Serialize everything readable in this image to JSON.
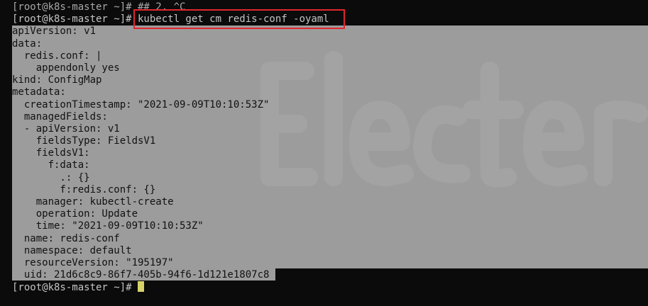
{
  "terminal": {
    "lines": [
      {
        "text": "[root@k8s-master ~]# ## 2. ^C",
        "style": "dim"
      },
      {
        "text": "[root@k8s-master ~]# kubectl get cm redis-conf -oyaml",
        "style": "prompt"
      },
      {
        "text": "apiVersion: v1",
        "style": "sel"
      },
      {
        "text": "data:",
        "style": "sel"
      },
      {
        "text": "  redis.conf: |",
        "style": "sel"
      },
      {
        "text": "    appendonly yes",
        "style": "sel"
      },
      {
        "text": "kind: ConfigMap",
        "style": "sel"
      },
      {
        "text": "metadata:",
        "style": "sel"
      },
      {
        "text": "  creationTimestamp: \"2021-09-09T10:10:53Z\"",
        "style": "sel"
      },
      {
        "text": "  managedFields:",
        "style": "sel"
      },
      {
        "text": "  - apiVersion: v1",
        "style": "sel"
      },
      {
        "text": "    fieldsType: FieldsV1",
        "style": "sel"
      },
      {
        "text": "    fieldsV1:",
        "style": "sel"
      },
      {
        "text": "      f:data:",
        "style": "sel"
      },
      {
        "text": "        .: {}",
        "style": "sel"
      },
      {
        "text": "        f:redis.conf: {}",
        "style": "sel"
      },
      {
        "text": "    manager: kubectl-create",
        "style": "sel"
      },
      {
        "text": "    operation: Update",
        "style": "sel"
      },
      {
        "text": "    time: \"2021-09-09T10:10:53Z\"",
        "style": "sel"
      },
      {
        "text": "  name: redis-conf",
        "style": "sel"
      },
      {
        "text": "  namespace: default",
        "style": "sel"
      },
      {
        "text": "  resourceVersion: \"195197\"",
        "style": "sel"
      },
      {
        "text": "  uid: 21d6c8c9-86f7-405b-94f6-1d121e1807c8",
        "style": "sel"
      },
      {
        "text": "[root@k8s-master ~]# ",
        "style": "prompt"
      }
    ],
    "highlighted_command": "kubectl get cm redis-conf -oyaml",
    "highlight_color": "#e0262c",
    "cursor_color": "#d8d26a",
    "selection_color": "#9c9c9c",
    "background_color": "#0b0b0b"
  }
}
